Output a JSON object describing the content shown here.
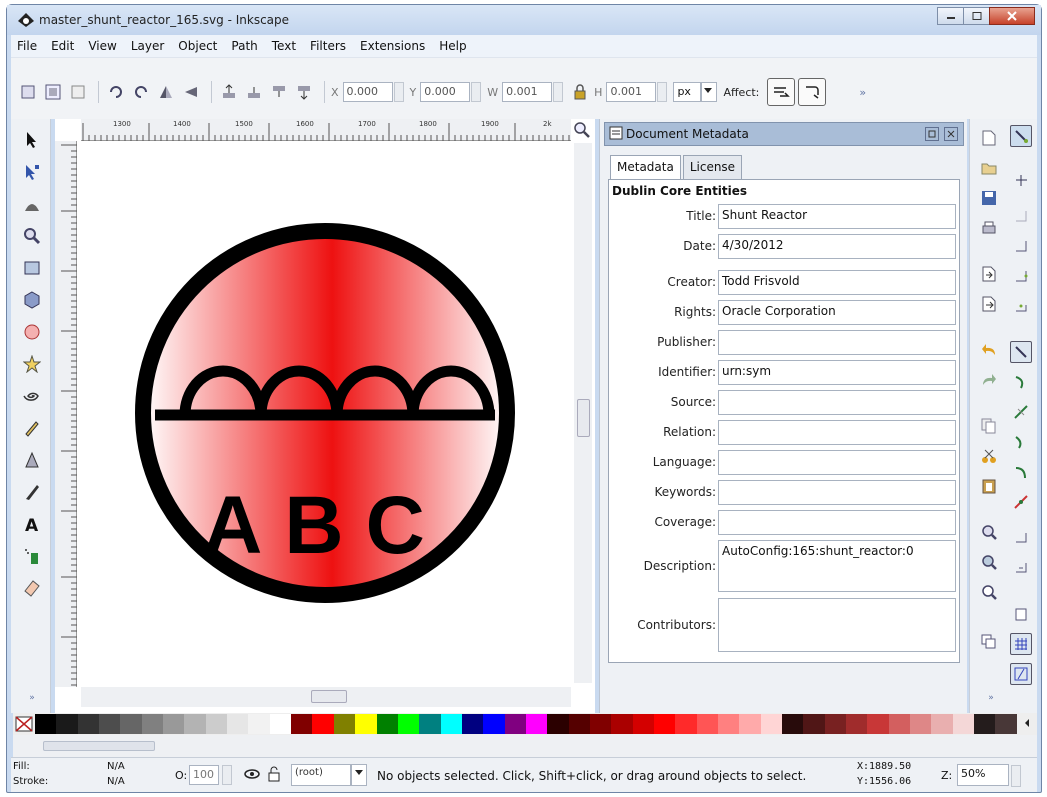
{
  "window": {
    "title": "master_shunt_reactor_165.svg - Inkscape"
  },
  "menu": [
    "File",
    "Edit",
    "View",
    "Layer",
    "Object",
    "Path",
    "Text",
    "Filters",
    "Extensions",
    "Help"
  ],
  "toolbar": {
    "x_label": "X",
    "x_value": "0.000",
    "y_label": "Y",
    "y_value": "0.000",
    "w_label": "W",
    "w_value": "0.001",
    "h_label": "H",
    "h_value": "0.001",
    "unit": "px",
    "affect_label": "Affect:",
    "more": "»"
  },
  "ruler": {
    "labels": [
      "1300",
      "1400",
      "1500",
      "1600",
      "1700",
      "1800",
      "1900",
      "2k"
    ]
  },
  "drawing": {
    "text": "ABC"
  },
  "panel": {
    "title": "Document Metadata",
    "tabs": [
      "Metadata",
      "License"
    ],
    "section": "Dublin Core Entities",
    "fields": [
      {
        "label": "Title:",
        "value": "Shunt Reactor"
      },
      {
        "label": "Date:",
        "value": "4/30/2012"
      },
      {
        "label": "Creator:",
        "value": "Todd Frisvold"
      },
      {
        "label": "Rights:",
        "value": "Oracle Corporation"
      },
      {
        "label": "Publisher:",
        "value": ""
      },
      {
        "label": "Identifier:",
        "value": "urn:sym"
      },
      {
        "label": "Source:",
        "value": ""
      },
      {
        "label": "Relation:",
        "value": ""
      },
      {
        "label": "Language:",
        "value": ""
      },
      {
        "label": "Keywords:",
        "value": ""
      },
      {
        "label": "Coverage:",
        "value": ""
      }
    ],
    "description": {
      "label": "Description:",
      "value": "AutoConfig:165:shunt_reactor:0"
    },
    "contributors": {
      "label": "Contributors:",
      "value": ""
    }
  },
  "status": {
    "fill_label": "Fill:",
    "fill_value": "N/A",
    "stroke_label": "Stroke:",
    "stroke_value": "N/A",
    "opacity_label": "O:",
    "opacity_value": "100",
    "layer": "(root)",
    "message": "No objects selected. Click, Shift+click, or drag around objects to select.",
    "x_coord": "X:1889.50",
    "y_coord": "Y:1556.06",
    "zoom_label": "Z:",
    "zoom_value": "50%"
  },
  "palette": [
    "#000000",
    "#1a1a1a",
    "#333333",
    "#4d4d4d",
    "#666666",
    "#808080",
    "#999999",
    "#b3b3b3",
    "#cccccc",
    "#e6e6e6",
    "#f2f2f2",
    "#ffffff",
    "#800000",
    "#ff0000",
    "#808000",
    "#ffff00",
    "#008000",
    "#00ff00",
    "#008080",
    "#00ffff",
    "#000080",
    "#0000ff",
    "#800080",
    "#ff00ff",
    "#2b0000",
    "#550000",
    "#800000",
    "#aa0000",
    "#d40000",
    "#ff0000",
    "#ff2a2a",
    "#ff5555",
    "#ff8080",
    "#ffaaaa",
    "#ffd5d5",
    "#280b0b",
    "#501616",
    "#782121",
    "#a02c2c",
    "#c83737",
    "#d35f5f",
    "#de8787",
    "#e9afaf",
    "#f4d7d7",
    "#241c1c",
    "#483737"
  ],
  "colors": {
    "accent": "#a9bdd7",
    "window": "#c9daf0",
    "symbol_red": "#ee1111"
  }
}
